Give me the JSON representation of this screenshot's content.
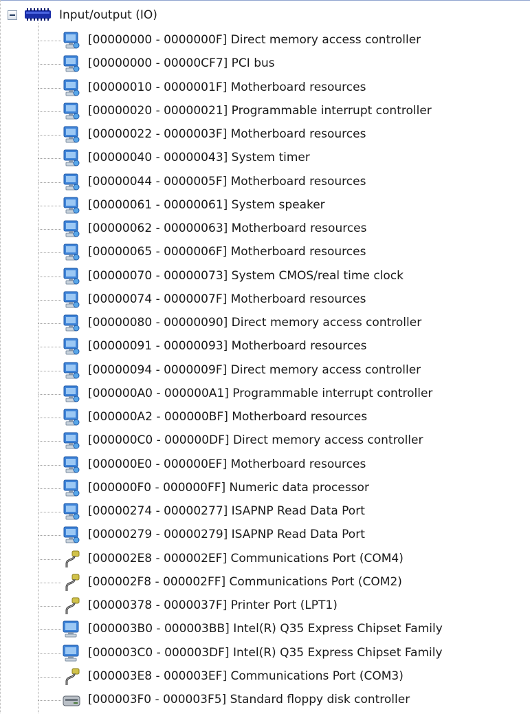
{
  "tree": {
    "root_label": "Input/output (IO)",
    "root_icon": "io-bus-icon",
    "items": [
      {
        "label": "[00000000 - 0000000F]  Direct memory access controller",
        "icon": "system-device-icon"
      },
      {
        "label": "[00000000 - 00000CF7]  PCI bus",
        "icon": "system-device-icon"
      },
      {
        "label": "[00000010 - 0000001F]  Motherboard resources",
        "icon": "system-device-icon"
      },
      {
        "label": "[00000020 - 00000021]  Programmable interrupt controller",
        "icon": "system-device-icon"
      },
      {
        "label": "[00000022 - 0000003F]  Motherboard resources",
        "icon": "system-device-icon"
      },
      {
        "label": "[00000040 - 00000043]  System timer",
        "icon": "system-device-icon"
      },
      {
        "label": "[00000044 - 0000005F]  Motherboard resources",
        "icon": "system-device-icon"
      },
      {
        "label": "[00000061 - 00000061]  System speaker",
        "icon": "system-device-icon"
      },
      {
        "label": "[00000062 - 00000063]  Motherboard resources",
        "icon": "system-device-icon"
      },
      {
        "label": "[00000065 - 0000006F]  Motherboard resources",
        "icon": "system-device-icon"
      },
      {
        "label": "[00000070 - 00000073]  System CMOS/real time clock",
        "icon": "system-device-icon"
      },
      {
        "label": "[00000074 - 0000007F]  Motherboard resources",
        "icon": "system-device-icon"
      },
      {
        "label": "[00000080 - 00000090]  Direct memory access controller",
        "icon": "system-device-icon"
      },
      {
        "label": "[00000091 - 00000093]  Motherboard resources",
        "icon": "system-device-icon"
      },
      {
        "label": "[00000094 - 0000009F]  Direct memory access controller",
        "icon": "system-device-icon"
      },
      {
        "label": "[000000A0 - 000000A1]  Programmable interrupt controller",
        "icon": "system-device-icon"
      },
      {
        "label": "[000000A2 - 000000BF]  Motherboard resources",
        "icon": "system-device-icon"
      },
      {
        "label": "[000000C0 - 000000DF]  Direct memory access controller",
        "icon": "system-device-icon"
      },
      {
        "label": "[000000E0 - 000000EF]  Motherboard resources",
        "icon": "system-device-icon"
      },
      {
        "label": "[000000F0 - 000000FF]  Numeric data processor",
        "icon": "system-device-icon"
      },
      {
        "label": "[00000274 - 00000277]  ISAPNP Read Data Port",
        "icon": "system-device-icon"
      },
      {
        "label": "[00000279 - 00000279]  ISAPNP Read Data Port",
        "icon": "system-device-icon"
      },
      {
        "label": "[000002E8 - 000002EF]  Communications Port (COM4)",
        "icon": "serial-port-icon"
      },
      {
        "label": "[000002F8 - 000002FF]  Communications Port (COM2)",
        "icon": "serial-port-icon"
      },
      {
        "label": "[00000378 - 0000037F]  Printer Port (LPT1)",
        "icon": "serial-port-icon"
      },
      {
        "label": "[000003B0 - 000003BB]  Intel(R) Q35 Express Chipset Family",
        "icon": "display-adapter-icon"
      },
      {
        "label": "[000003C0 - 000003DF]  Intel(R) Q35 Express Chipset Family",
        "icon": "display-adapter-icon"
      },
      {
        "label": "[000003E8 - 000003EF]  Communications Port (COM3)",
        "icon": "serial-port-icon"
      },
      {
        "label": "[000003F0 - 000003F5]  Standard floppy disk controller",
        "icon": "floppy-controller-icon"
      }
    ]
  },
  "colors": {
    "text": "#1a1a1a",
    "tree_line": "#a0a0a0",
    "frame": "#8fa4cf",
    "system_icon": "#3f84d8",
    "port_icon": "#d1c24a",
    "root_icon": "#1a2ea8"
  }
}
